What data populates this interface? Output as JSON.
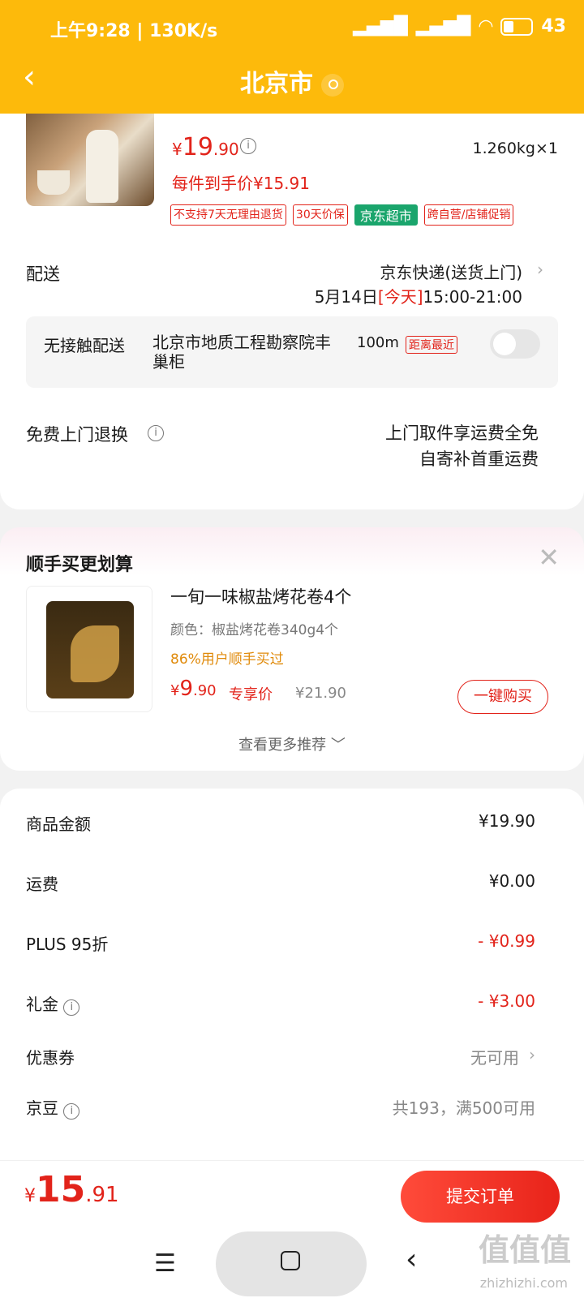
{
  "status_bar": {
    "time": "上午9:28",
    "speed": "130K/s",
    "battery": "43"
  },
  "header": {
    "back_icon": "chevron-left-icon",
    "title": "北京市",
    "location_icon": "location-pin-icon"
  },
  "product": {
    "currency": "¥",
    "price_int": "19",
    "price_dec": ".90",
    "weight_qty": "1.260kg×1",
    "net_price": "每件到手价¥15.91",
    "tags": [
      "不支持7天无理由退货",
      "30天价保",
      "京东超市",
      "跨自营/店铺促销"
    ]
  },
  "delivery": {
    "label": "配送",
    "method": "京东快递(送货上门)",
    "date": "5月14日",
    "today": "[今天]",
    "time_window": "15:00-21:00"
  },
  "contactless": {
    "label": "无接触配送",
    "place": "北京市地质工程勘察院丰巢柜",
    "distance": "100m",
    "nearest": "距离最近",
    "enabled": false
  },
  "free_return": {
    "label": "免费上门退换",
    "line1": "上门取件享运费全免",
    "line2": "自寄补首重运费"
  },
  "recommend": {
    "title": "顺手买更划算",
    "close_icon": "close-icon",
    "item": {
      "name": "一旬一味椒盐烤花卷4个",
      "spec": "颜色：椒盐烤花卷340g4个",
      "bought": "86%用户顺手买过",
      "currency": "¥",
      "price_int": "9",
      "price_dec": ".90",
      "exclusive": "专享价",
      "orig_price": "¥21.90",
      "buy_label": "一键购买"
    },
    "see_more": "查看更多推荐 ﹀"
  },
  "summary": {
    "rows": [
      {
        "label": "商品金额",
        "value": "¥19.90"
      },
      {
        "label": "运费",
        "value": "¥0.00"
      },
      {
        "label": "PLUS 95折",
        "value": "- ¥0.99"
      },
      {
        "label": "礼金",
        "value": "- ¥3.00"
      },
      {
        "label": "优惠券",
        "value": "无可用"
      },
      {
        "label": "京豆",
        "value": "共193，满500可用"
      }
    ]
  },
  "bottom": {
    "currency": "¥",
    "total_int": "15",
    "total_dec": ".91",
    "submit_label": "提交订单"
  },
  "watermark": {
    "text": "值值值",
    "url": "zhizhizhi.com"
  }
}
